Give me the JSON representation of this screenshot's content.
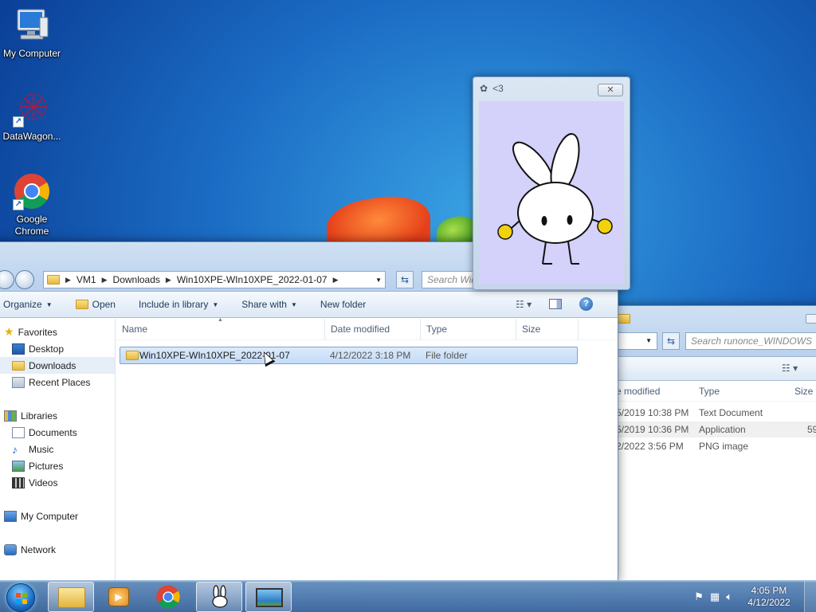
{
  "desktop": {
    "icons": [
      {
        "label": "My Computer"
      },
      {
        "label": "DataWagon..."
      },
      {
        "label": "Google\nChrome"
      }
    ]
  },
  "popup": {
    "title": "<3",
    "close_glyph": "✕"
  },
  "explorer": {
    "breadcrumb": [
      "VM1",
      "Downloads",
      "Win10XPE-WIn10XPE_2022-01-07"
    ],
    "search_placeholder": "Search Win",
    "toolbar": {
      "organize": "Organize",
      "open": "Open",
      "include_in_library": "Include in library",
      "share_with": "Share with",
      "new_folder": "New folder"
    },
    "nav": {
      "favorites": "Favorites",
      "desktop": "Desktop",
      "downloads": "Downloads",
      "recent_places": "Recent Places",
      "libraries": "Libraries",
      "documents": "Documents",
      "music": "Music",
      "pictures": "Pictures",
      "videos": "Videos",
      "my_computer": "My Computer",
      "network": "Network"
    },
    "columns": {
      "name": "Name",
      "date_modified": "Date modified",
      "type": "Type",
      "size": "Size"
    },
    "rows": [
      {
        "name": "Win10XPE-WIn10XPE_2022-01-07",
        "date": "4/12/2022 3:18 PM",
        "type": "File folder",
        "size": ""
      }
    ]
  },
  "explorer_back": {
    "search_placeholder": "Search runonce_WINDOWS",
    "columns": {
      "date_modified": "e modified",
      "type": "Type",
      "size": "Size"
    },
    "rows": [
      {
        "date": "5/2019 10:38 PM",
        "type": "Text Document",
        "size": ""
      },
      {
        "date": "5/2019 10:36 PM",
        "type": "Application",
        "size": "59"
      },
      {
        "date": "2/2022 3:56 PM",
        "type": "PNG image",
        "size": ""
      }
    ]
  },
  "taskbar": {
    "time": "4:05 PM",
    "date": "4/12/2022"
  }
}
